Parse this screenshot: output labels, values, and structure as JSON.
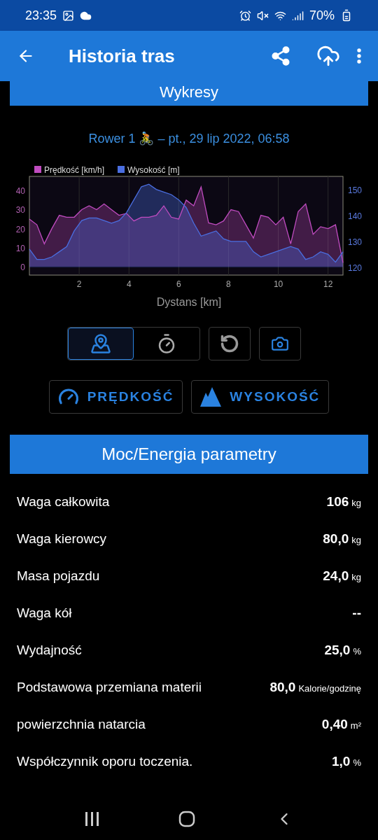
{
  "status_bar": {
    "time": "23:35",
    "battery": "70%"
  },
  "app_bar": {
    "title": "Historia tras"
  },
  "charts_section": {
    "title": "Wykresy",
    "ride_title": "Rower 1 🚴 – pt., 29 lip 2022, 06:58",
    "chart_data": {
      "type": "area",
      "xlabel": "Dystans [km]",
      "xlim": [
        0,
        12.6
      ],
      "ylim": [
        -4.5,
        47.5
      ],
      "y2lim": [
        117,
        155
      ],
      "grid": true,
      "legend": true,
      "x": [
        0,
        0.3,
        0.6,
        0.9,
        1.2,
        1.5,
        1.8,
        2.1,
        2.4,
        2.7,
        3,
        3.3,
        3.6,
        3.9,
        4.2,
        4.5,
        4.8,
        5.1,
        5.4,
        5.7,
        6,
        6.3,
        6.6,
        6.9,
        7.2,
        7.5,
        7.8,
        8.1,
        8.4,
        8.7,
        9,
        9.3,
        9.6,
        9.9,
        10.2,
        10.5,
        10.8,
        11.1,
        11.4,
        11.7,
        12,
        12.3,
        12.6
      ],
      "xticks": [
        2,
        4,
        6,
        8,
        10,
        12
      ],
      "yticks": [
        0,
        10,
        20,
        30,
        40
      ],
      "y2ticks": [
        120,
        130,
        140,
        150
      ],
      "series": [
        {
          "name": "Prędkość [km/h]",
          "color": "#c04cc0",
          "values": [
            25,
            22,
            12,
            20,
            27,
            26,
            26,
            30,
            32,
            30,
            33,
            30,
            27,
            28,
            24,
            26,
            26,
            27,
            32,
            26,
            25,
            35,
            32,
            42,
            23,
            22,
            24,
            30,
            29,
            22,
            15,
            27,
            26,
            22,
            26,
            12,
            29,
            33,
            17,
            21,
            20,
            22,
            2
          ]
        },
        {
          "name": "Wysokość [m]",
          "color": "#4a6ee0",
          "axis": "y2",
          "values": [
            127,
            123,
            123,
            124,
            126,
            128,
            134,
            138,
            139,
            139,
            138,
            137,
            138,
            141,
            146,
            151,
            152,
            150,
            149,
            148,
            146,
            143,
            137,
            132,
            133,
            134,
            131,
            130,
            130,
            130,
            126,
            124,
            125,
            126,
            127,
            128,
            127,
            123,
            124,
            126,
            125,
            122,
            126
          ]
        }
      ]
    },
    "modes": [
      {
        "kind": "route",
        "selected": true
      },
      {
        "kind": "timer",
        "selected": false
      }
    ],
    "metric_buttons": [
      {
        "kind": "speed",
        "label": "PRĘDKOŚĆ"
      },
      {
        "kind": "elevation",
        "label": "WYSOKOŚĆ"
      }
    ]
  },
  "power_section": {
    "title": "Moc/Energia parametry",
    "rows": [
      {
        "label": "Waga całkowita",
        "value": "106",
        "unit": "kg"
      },
      {
        "label": "Waga kierowcy",
        "value": "80,0",
        "unit": "kg"
      },
      {
        "label": "Masa pojazdu",
        "value": "24,0",
        "unit": "kg"
      },
      {
        "label": "Waga kół",
        "value": "--"
      },
      {
        "label": "Wydajność",
        "value": "25,0",
        "unit": "%"
      },
      {
        "label": "Podstawowa przemiana materii",
        "value": "80,0",
        "unit": "Kalorie/godzinę"
      },
      {
        "label": "powierzchnia natarcia",
        "value": "0,40",
        "unit": "m²"
      },
      {
        "label": "Współczynnik oporu toczenia.",
        "value": "1,0",
        "unit": "%"
      }
    ]
  }
}
